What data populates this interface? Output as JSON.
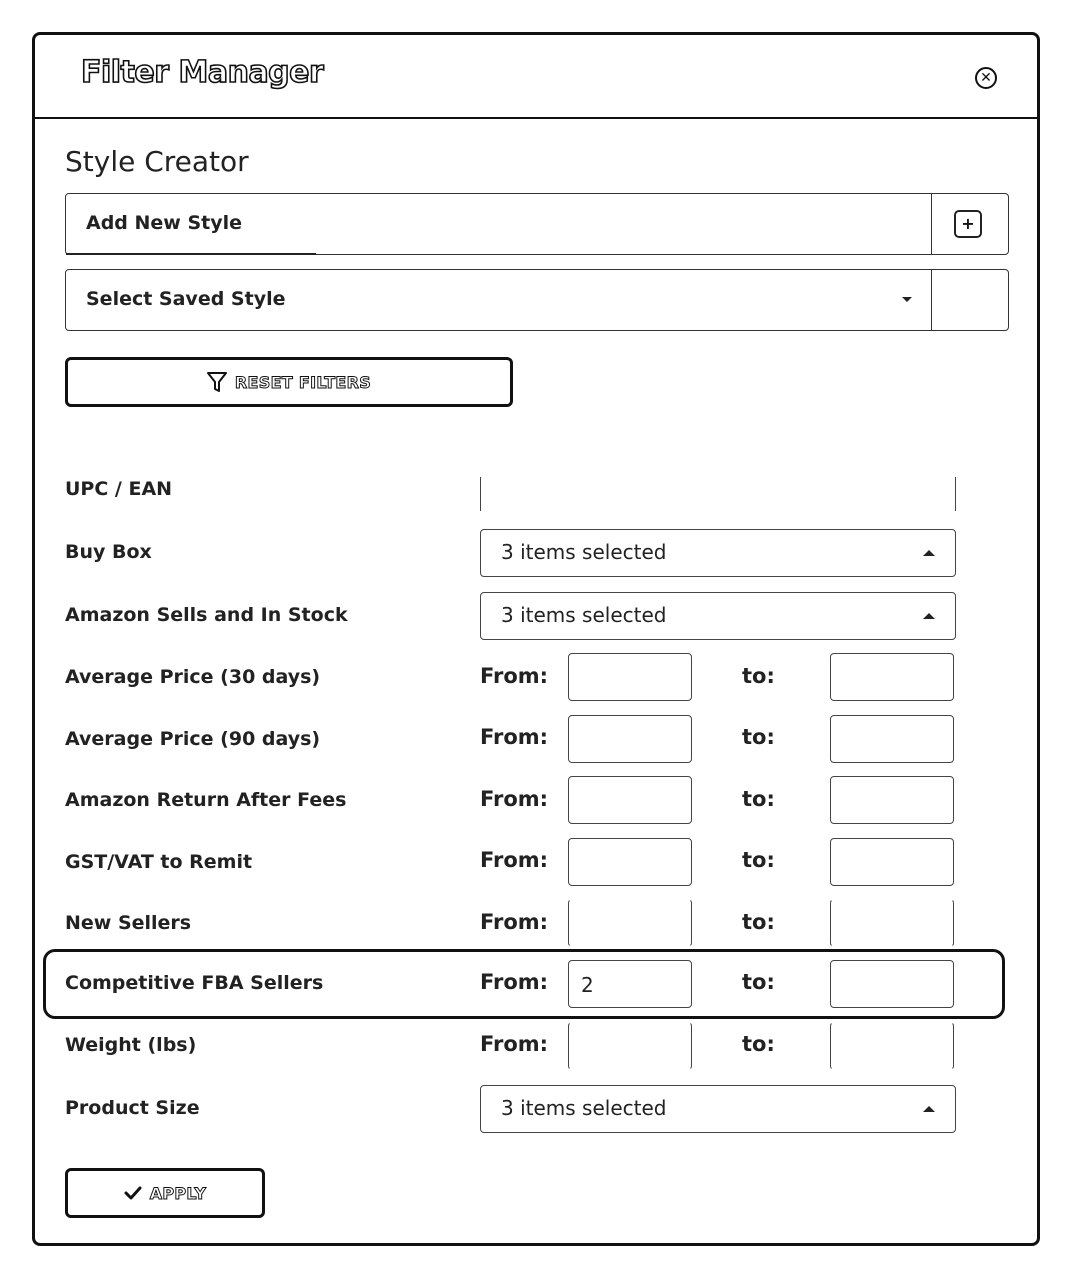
{
  "dialog": {
    "title": "Filter Manager",
    "close_icon": "close-circle-icon"
  },
  "style_creator": {
    "heading": "Style Creator",
    "add_new_style_label": "Add New Style",
    "add_icon": "plus-square-icon",
    "select_saved_style_label": "Select Saved Style",
    "dropdown_icon": "chevron-down-icon"
  },
  "buttons": {
    "reset_label": "RESET FILTERS",
    "reset_icon": "filter-icon",
    "apply_label": "APPLY",
    "apply_icon": "check-icon"
  },
  "range_labels": {
    "from": "From:",
    "to": "to:"
  },
  "filters": {
    "upc": {
      "label": "UPC / EAN",
      "value": ""
    },
    "buy_box": {
      "label": "Buy Box",
      "value": "3 items selected"
    },
    "amazon_sells": {
      "label": "Amazon Sells and In Stock",
      "value": "3 items selected"
    },
    "avg_price_30": {
      "label": "Average Price (30 days)",
      "from": "",
      "to": ""
    },
    "avg_price_90": {
      "label": "Average Price (90 days)",
      "from": "",
      "to": ""
    },
    "amazon_return": {
      "label": "Amazon Return After Fees",
      "from": "",
      "to": ""
    },
    "gst_vat": {
      "label": "GST/VAT to Remit",
      "from": "",
      "to": ""
    },
    "new_sellers": {
      "label": "New Sellers",
      "from": "",
      "to": ""
    },
    "competitive_fba": {
      "label": "Competitive FBA Sellers",
      "from": "2",
      "to": ""
    },
    "weight": {
      "label": "Weight (lbs)",
      "from": "",
      "to": ""
    },
    "product_size": {
      "label": "Product Size",
      "value": "3 items selected"
    }
  }
}
